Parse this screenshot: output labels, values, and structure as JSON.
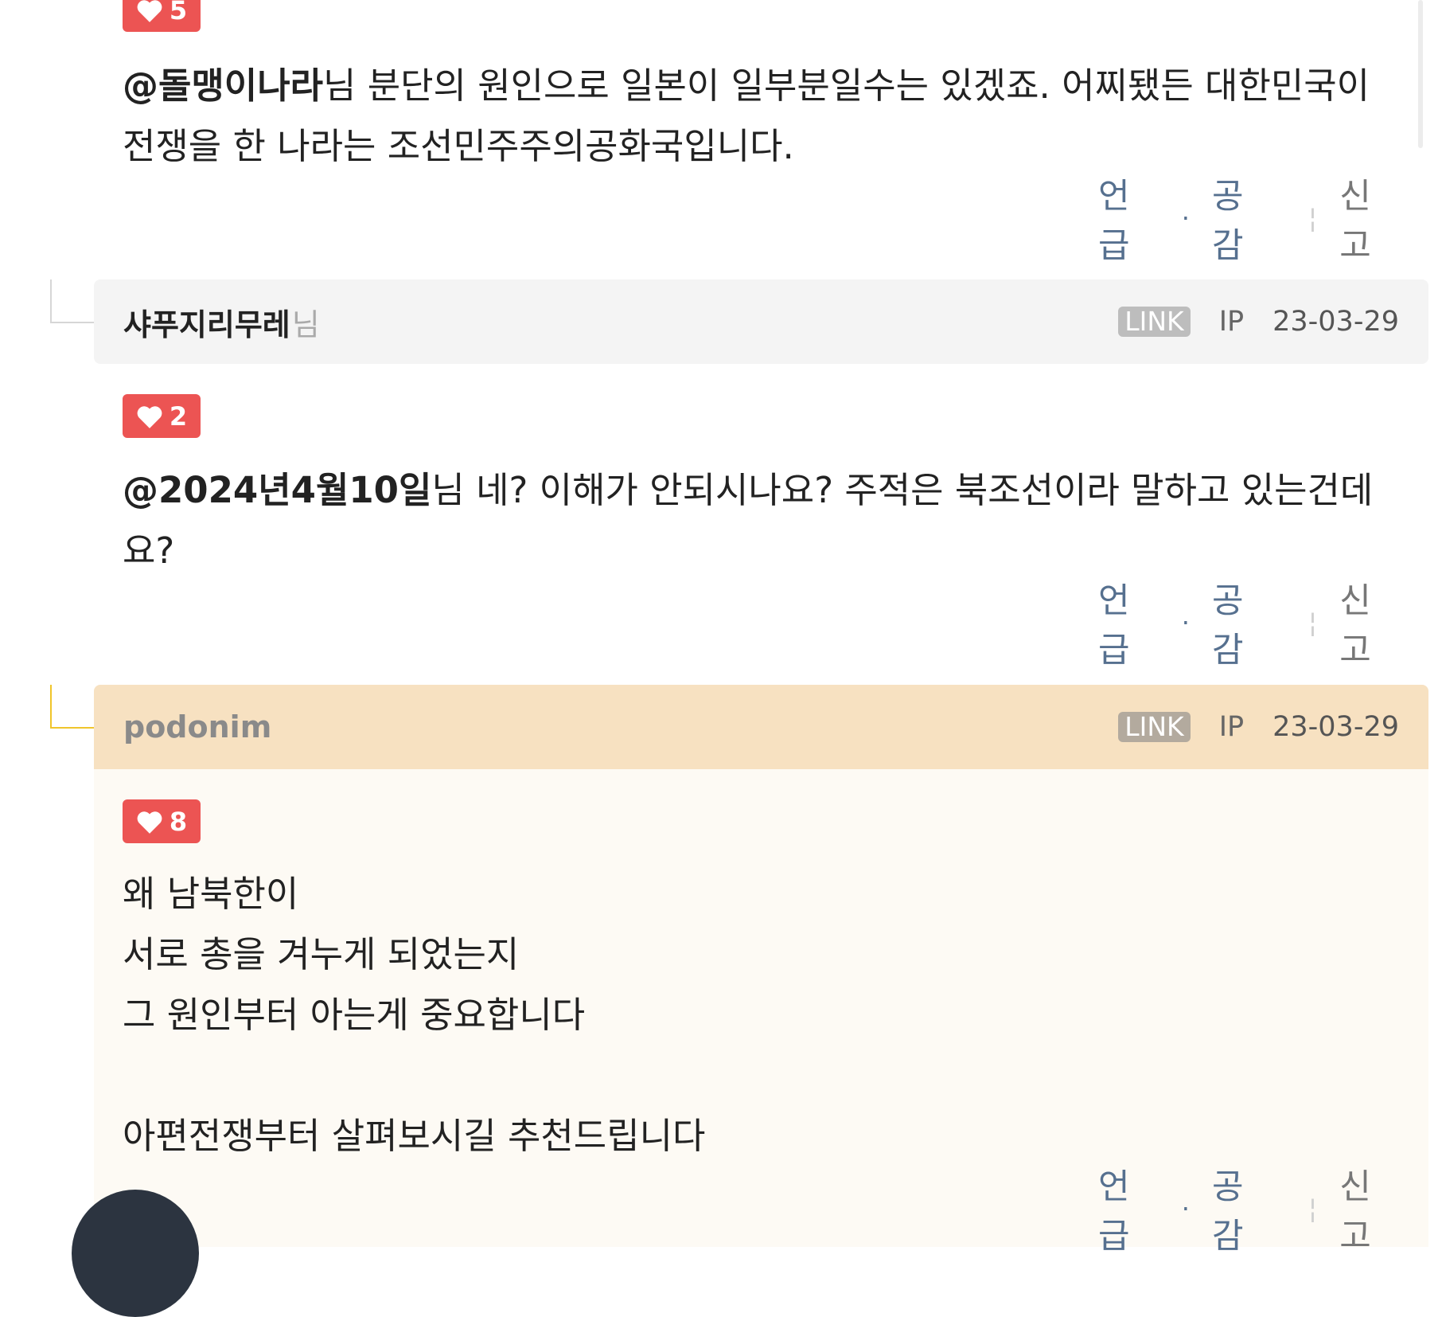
{
  "comments": [
    {
      "likes": "5",
      "mention": "@돌맹이나라",
      "text": "님 분단의 원인으로 일본이 일부분일수는 있겠죠. 어찌됐든 대한민국이 전쟁을 한 나라는 조선민주주의공화국입니다.",
      "actions": {
        "mention": "언급",
        "dot": "·",
        "empathy": "공감",
        "report": "신고"
      }
    },
    {
      "author": "샤푸지리무레",
      "author_suffix": "님",
      "link_badge": "LINK",
      "ip": "IP",
      "date": "23-03-29",
      "likes": "2",
      "mention": "@2024년4월10일",
      "text": "님 네? 이해가 안되시나요? 주적은 북조선이라 말하고 있는건데요?",
      "actions": {
        "mention": "언급",
        "dot": "·",
        "empathy": "공감",
        "report": "신고"
      }
    },
    {
      "author": "podonim",
      "link_badge": "LINK",
      "ip": "IP",
      "date": "23-03-29",
      "likes": "8",
      "lines": [
        "왜 남북한이",
        "서로 총을 겨누게 되었는지",
        "그 원인부터 아는게 중요합니다",
        "",
        "아편전쟁부터 살펴보시길 추천드립니다"
      ],
      "actions": {
        "mention": "언급",
        "dot": "·",
        "empathy": "공감",
        "report": "신고"
      }
    }
  ],
  "icons": {
    "like": "heart-icon",
    "fab": "floating-button"
  },
  "colors": {
    "like_badge": "#ec5453",
    "action_link": "#56708f",
    "reply_header": "#f7e1c1",
    "thread_gold": "#f0c52b"
  }
}
